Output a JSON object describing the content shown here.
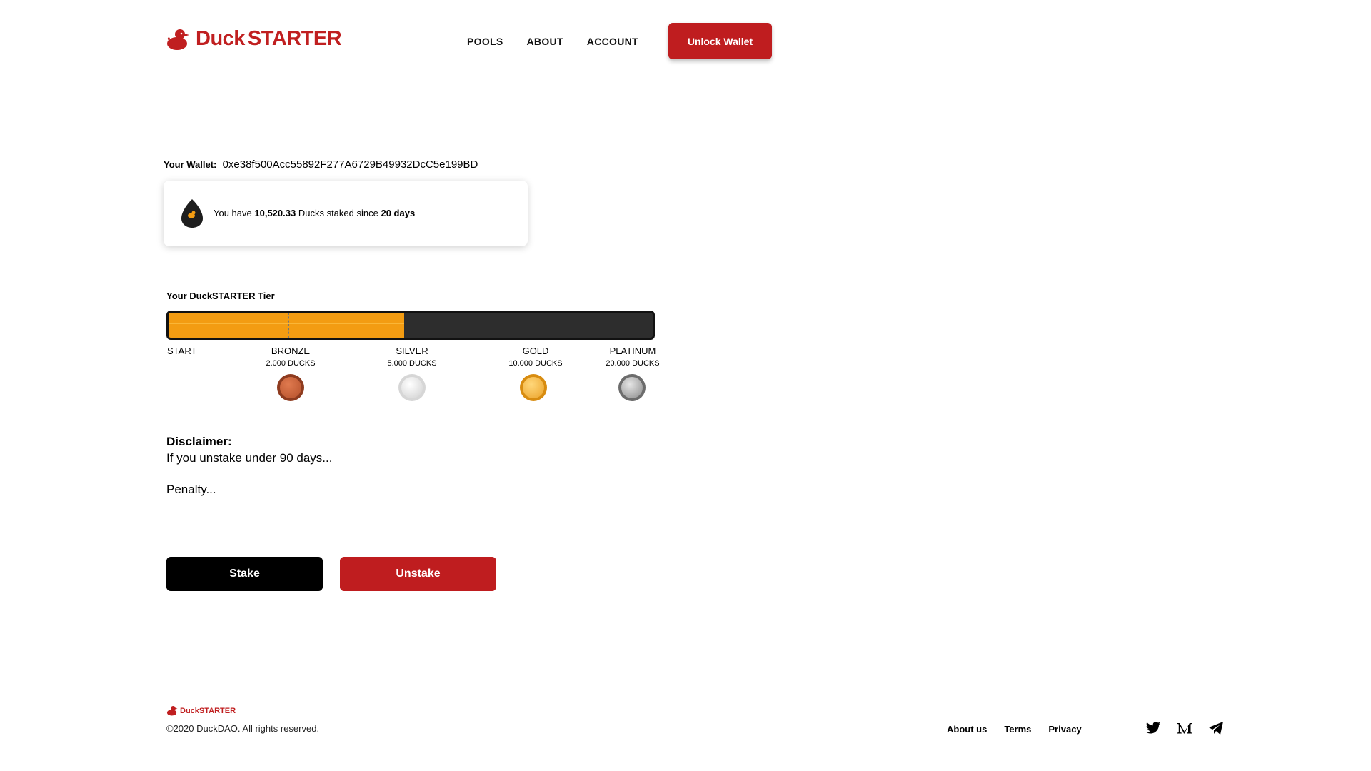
{
  "header": {
    "logo_part1": "Duck",
    "logo_part2": "STARTER",
    "nav": [
      "POOLS",
      "ABOUT",
      "ACCOUNT"
    ],
    "unlock_label": "Unlock Wallet"
  },
  "wallet": {
    "label": "Your Wallet:",
    "address": "0xe38f500Acc55892F277A6729B49932DcC5e199BD"
  },
  "stake_info": {
    "prefix": "You have",
    "amount": "10,520.33",
    "middle": "Ducks staked since",
    "days": "20 days"
  },
  "tier": {
    "title": "Your DuckSTARTER Tier",
    "progress_fraction": 0.487,
    "levels": [
      {
        "name": "START",
        "req": ""
      },
      {
        "name": "BRONZE",
        "req": "2.000 DUCKS"
      },
      {
        "name": "SILVER",
        "req": "5.000 DUCKS"
      },
      {
        "name": "GOLD",
        "req": "10.000 DUCKS"
      },
      {
        "name": "PLATINUM",
        "req": "20.000 DUCKS"
      }
    ]
  },
  "disclaimer": {
    "title": "Disclaimer:",
    "line1": "If you unstake under 90 days...",
    "line2": "Penalty..."
  },
  "actions": {
    "stake_label": "Stake",
    "unstake_label": "Unstake"
  },
  "footer": {
    "logo_part1": "Duck",
    "logo_part2": "STARTER",
    "copyright": "©2020 DuckDAO. All rights reserved.",
    "links": [
      "About us",
      "Terms",
      "Privacy"
    ],
    "social_icons": [
      "twitter-icon",
      "medium-icon",
      "telegram-icon"
    ]
  },
  "colors": {
    "brand_red": "#bf1d1f",
    "tier_fill": "#f39c12",
    "tier_track": "#2d2d2d",
    "bronze": "#b8532f",
    "silver": "#cfcfcf",
    "gold": "#f0a92a",
    "platinum": "#8a8a8a"
  }
}
